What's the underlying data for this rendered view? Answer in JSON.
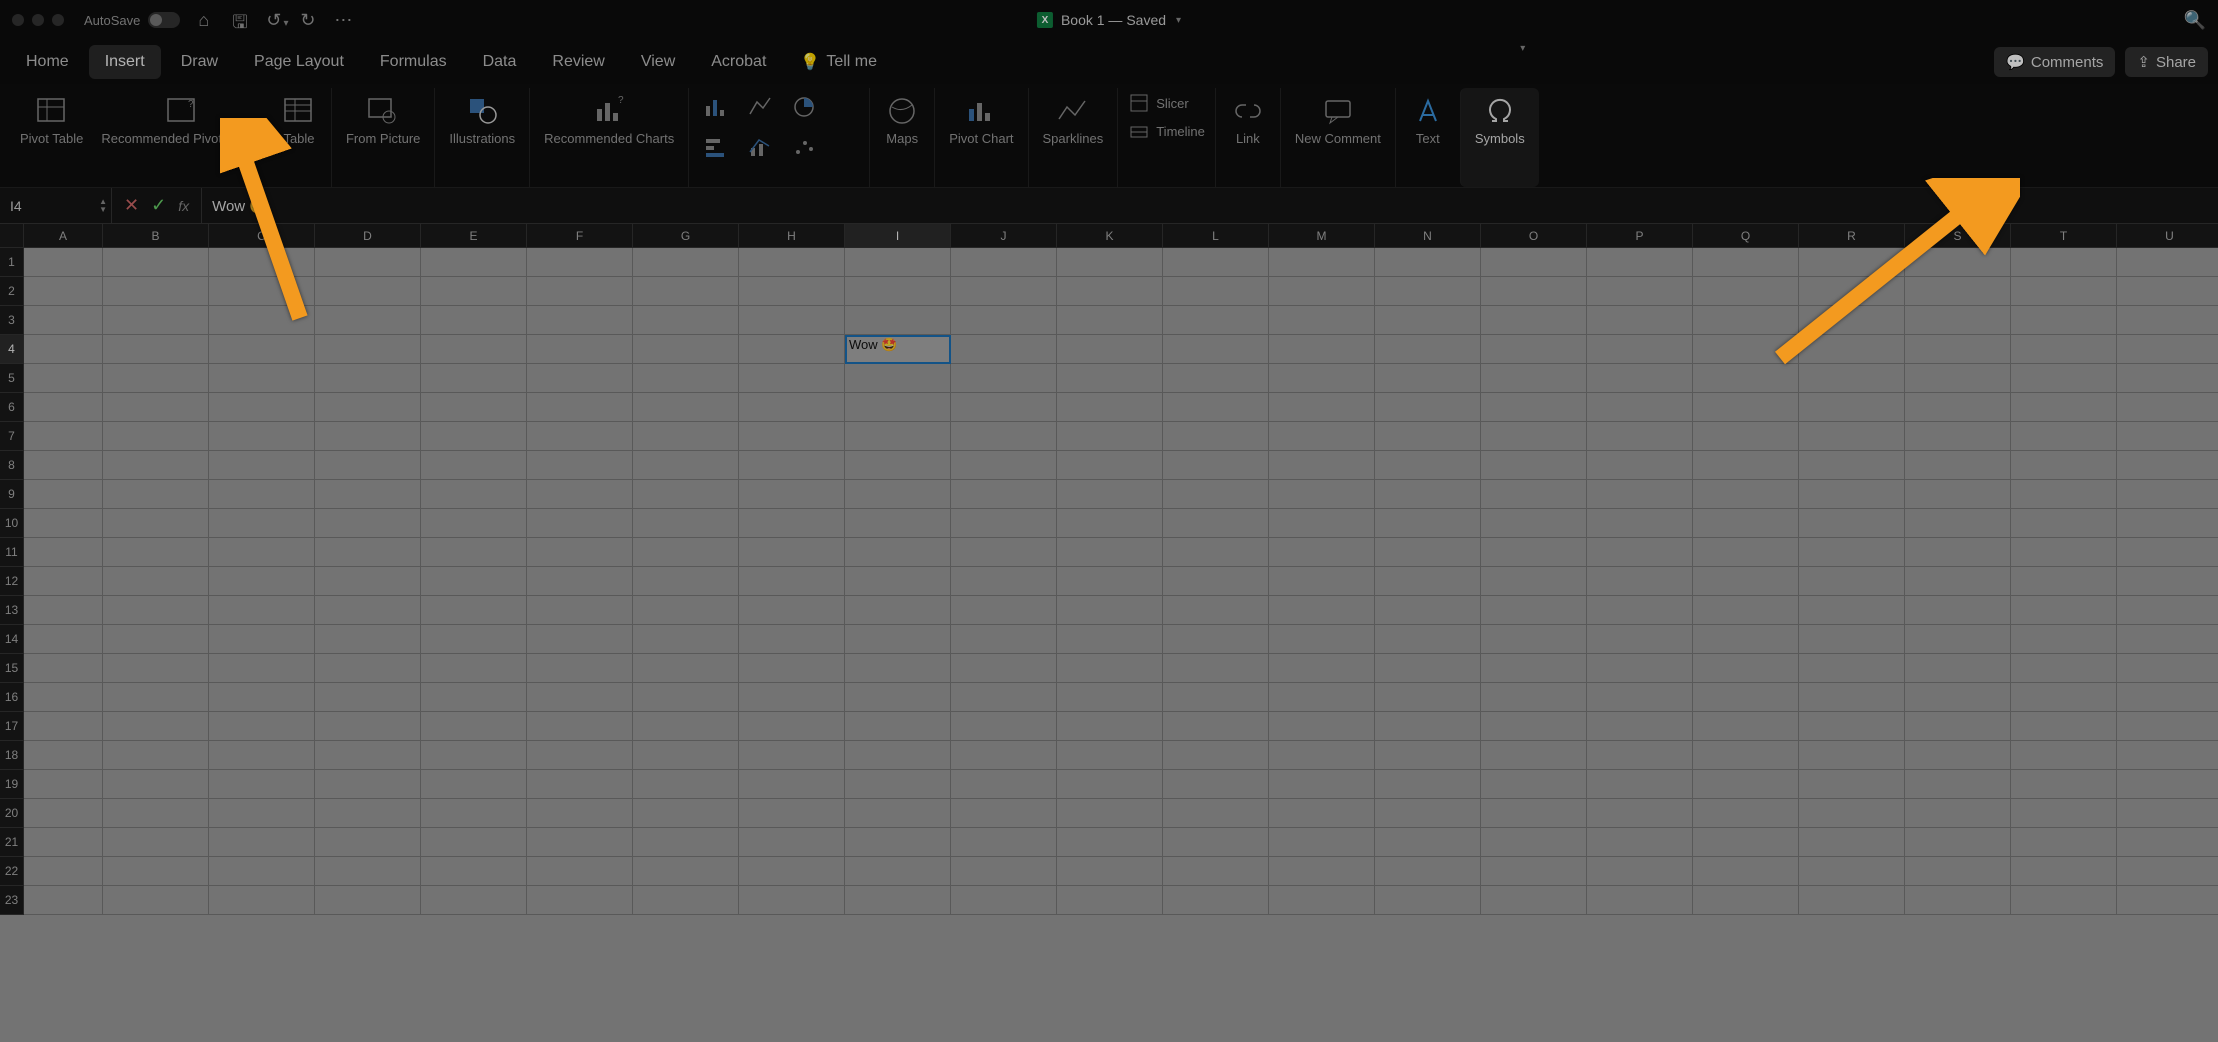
{
  "titlebar": {
    "autosave_label": "AutoSave",
    "doc_title": "Book 1 — Saved"
  },
  "tabs": {
    "items": [
      "Home",
      "Insert",
      "Draw",
      "Page Layout",
      "Formulas",
      "Data",
      "Review",
      "View",
      "Acrobat"
    ],
    "active_index": 1,
    "tellme": "Tell me",
    "comments": "Comments",
    "share": "Share"
  },
  "ribbon": {
    "pivot_table": "Pivot\nTable",
    "rec_pivot": "Recommended\nPivot Tables",
    "table": "Table",
    "from_picture": "From\nPicture",
    "illustrations": "Illustrations",
    "rec_charts": "Recommended\nCharts",
    "maps": "Maps",
    "pivot_chart": "Pivot\nChart",
    "sparklines": "Sparklines",
    "slicer": "Slicer",
    "timeline": "Timeline",
    "link": "Link",
    "new_comment": "New\nComment",
    "text": "Text",
    "symbols": "Symbols"
  },
  "formula_bar": {
    "name_box": "I4",
    "value": "Wow 🤩"
  },
  "grid": {
    "columns": [
      "A",
      "B",
      "C",
      "D",
      "E",
      "F",
      "G",
      "H",
      "I",
      "J",
      "K",
      "L",
      "M",
      "N",
      "O",
      "P",
      "Q",
      "R",
      "S",
      "T",
      "U"
    ],
    "row_count": 23,
    "active_col": "I",
    "active_row": 4,
    "cells": {
      "I4": "Wow 🤩"
    }
  }
}
